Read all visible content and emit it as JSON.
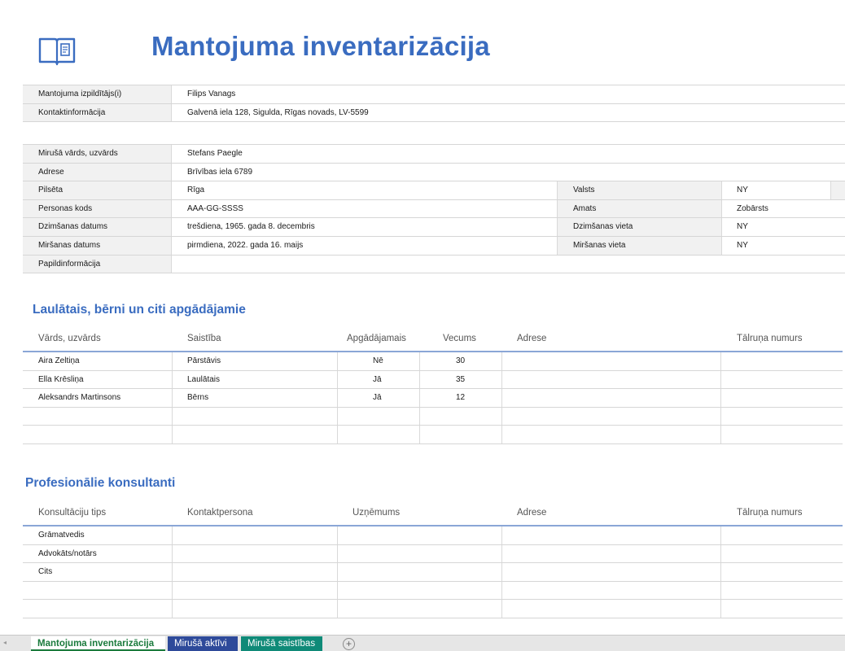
{
  "title": "Mantojuma inventarizācija",
  "icons": {
    "header": "open-book-icon",
    "add_sheet": "plus-circle-icon"
  },
  "executor": {
    "rows": [
      {
        "label": "Mantojuma izpildītājs(i)",
        "value": "Filips Vanags"
      },
      {
        "label": "Kontaktinformācija",
        "value": "Galvenā iela 128, Sigulda, Rīgas novads, LV-5599"
      }
    ]
  },
  "deceased": {
    "rows": [
      {
        "label": "Mirušā vārds, uzvārds",
        "value": "Stefans Paegle"
      },
      {
        "label": "Adrese",
        "value": "Brīvības iela 6789"
      },
      {
        "label": "Pilsēta",
        "value": "Rīga",
        "label2": "Valsts",
        "value2": "NY"
      },
      {
        "label": "Personas kods",
        "value": "AAA-GG-SSSS",
        "label2": "Amats",
        "value2": "Zobārsts"
      },
      {
        "label": "Dzimšanas datums",
        "value": "trešdiena, 1965. gada 8. decembris",
        "label2": "Dzimšanas vieta",
        "value2": "NY"
      },
      {
        "label": "Miršanas datums",
        "value": "pirmdiena, 2022. gada 16. maijs",
        "label2": "Miršanas vieta",
        "value2": "NY"
      },
      {
        "label": "Papildinformācija",
        "value": ""
      }
    ]
  },
  "dependents": {
    "title": "Laulātais, bērni un citi apgādājamie",
    "headers": [
      "Vārds, uzvārds",
      "Saistība",
      "Apgādājamais",
      "Vecums",
      "Adrese",
      "Tālruņa numurs"
    ],
    "rows": [
      [
        "Aira Zeltiņa",
        "Pārstāvis",
        "Nē",
        "30",
        "",
        ""
      ],
      [
        "Ella Krēsliņa",
        "Laulātais",
        "Jā",
        "35",
        "",
        ""
      ],
      [
        "Aleksandrs Martinsons",
        "Bērns",
        "Jā",
        "12",
        "",
        ""
      ],
      [
        "",
        "",
        "",
        "",
        "",
        ""
      ],
      [
        "",
        "",
        "",
        "",
        "",
        ""
      ]
    ]
  },
  "advisors": {
    "title": "Profesionālie konsultanti",
    "headers": [
      "Konsultāciju tips",
      "Kontaktpersona",
      "Uzņēmums",
      "Adrese",
      "Tālruņa numurs"
    ],
    "rows": [
      [
        "Grāmatvedis",
        "",
        "",
        "",
        ""
      ],
      [
        "Advokāts/notārs",
        "",
        "",
        "",
        ""
      ],
      [
        "Cits",
        "",
        "",
        "",
        ""
      ],
      [
        "",
        "",
        "",
        "",
        ""
      ],
      [
        "",
        "",
        "",
        "",
        ""
      ]
    ]
  },
  "sheet_tabs": [
    {
      "label": "Mantojuma inventarizācija",
      "color": "#1a7a3c"
    },
    {
      "label": "Mirušā aktīvi",
      "color": "#2e4a9a"
    },
    {
      "label": "Mirušā saistības",
      "color": "#0f8a78"
    }
  ],
  "colors": {
    "accent": "#3a6cc0",
    "header_line": "#8aa6d6"
  }
}
